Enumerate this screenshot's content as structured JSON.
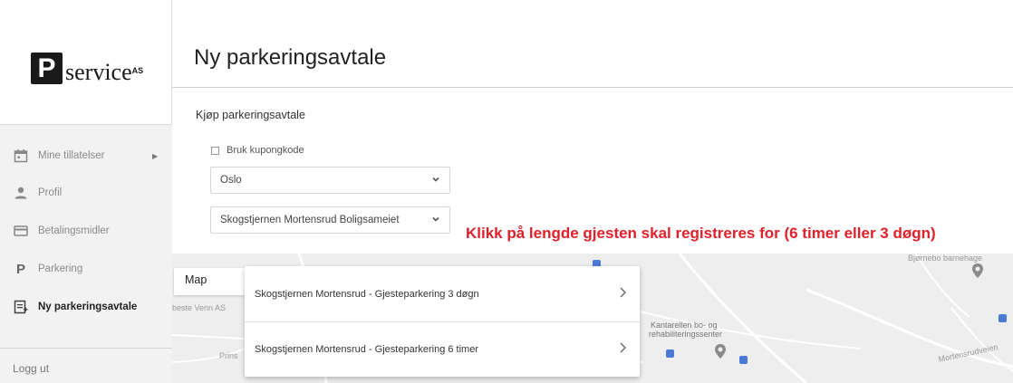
{
  "brand": {
    "logo_letter": "P",
    "logo_name": "service",
    "logo_suffix": "AS"
  },
  "sidebar": {
    "items": [
      {
        "label": "Mine tillatelser",
        "icon": "calendar-icon",
        "has_arrow": true,
        "active": false
      },
      {
        "label": "Profil",
        "icon": "person-icon",
        "active": false
      },
      {
        "label": "Betalingsmidler",
        "icon": "credit-card-icon",
        "active": false
      },
      {
        "label": "Parkering",
        "icon": "parking-p-icon",
        "active": false
      },
      {
        "label": "Ny parkeringsavtale",
        "icon": "new-document-icon",
        "active": true
      }
    ],
    "logout_label": "Logg ut"
  },
  "page": {
    "title": "Ny parkeringsavtale",
    "section_title": "Kjøp parkeringsavtale",
    "coupon_label": "Bruk kupongkode",
    "coupon_checked": false,
    "city_select": {
      "value": "Oslo"
    },
    "location_select": {
      "value": "Skogstjernen Mortensrud Boligsameiet"
    },
    "instruction": "Klikk på lengde gjesten skal registreres for (6 timer eller 3 døgn)"
  },
  "map": {
    "tab_label": "Map",
    "labels": {
      "bjornebo": "Bjørnebo barnehage",
      "kantarellen": "Kantarellen bo- og",
      "kantarellen2": "rehabiliteringssenter",
      "beste_venn": "beste Venn AS",
      "prins": "Prins",
      "mortensrudveien": "Mortensrudveien"
    },
    "options": [
      {
        "label": "Skogstjernen Mortensrud - Gjesteparkering 3 døgn"
      },
      {
        "label": "Skogstjernen Mortensrud - Gjesteparkering 6 timer"
      }
    ]
  },
  "colors": {
    "instruction": "#e0202a",
    "sidebar_bg": "#f2f2f2",
    "map_bg": "#eeeeee"
  }
}
